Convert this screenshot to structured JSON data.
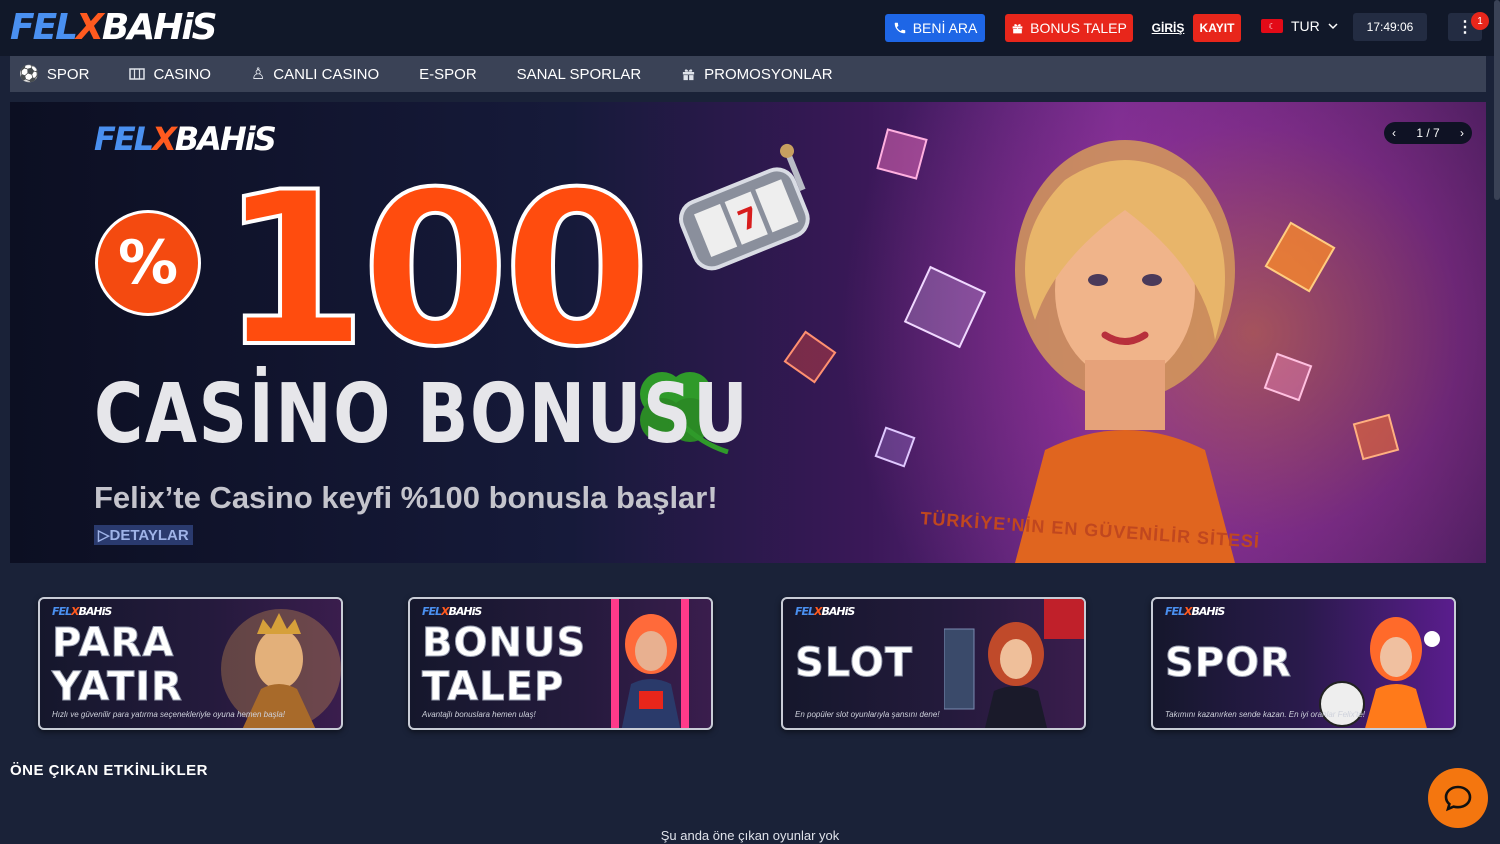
{
  "brand": {
    "part1": "FEL",
    "part2": "X",
    "part3": "BAHiS"
  },
  "header": {
    "call_label": "BENİ ARA",
    "bonus_label": "BONUS TALEP",
    "login_label": "GİRİŞ",
    "register_label": "KAYIT",
    "language": "TUR",
    "time": "17:49:06",
    "notification_count": "1"
  },
  "nav": {
    "items": [
      {
        "label": "SPOR",
        "icon": "soccer-ball-icon"
      },
      {
        "label": "CASINO",
        "icon": "slot-machine-icon"
      },
      {
        "label": "CANLI CASINO",
        "icon": "dealer-icon"
      },
      {
        "label": "E-SPOR",
        "icon": ""
      },
      {
        "label": "SANAL SPORLAR",
        "icon": ""
      },
      {
        "label": "PROMOSYONLAR",
        "icon": "gift-icon"
      }
    ]
  },
  "hero": {
    "percent": "%",
    "amount": "100",
    "title": "CASİNO BONUSU",
    "subtitle": "Felix’te Casino keyfi %100 bonusla başlar!",
    "details_label": "DETAYLAR",
    "tagline": "TÜRKİYE'NİN EN GÜVENİLİR SİTESİ",
    "pager": "1 / 7"
  },
  "promos": [
    {
      "title_line1": "PARA",
      "title_line2": "YATIR",
      "desc": "Hızlı ve güvenilir para yatırma seçenekleriyle oyuna hemen başla!"
    },
    {
      "title_line1": "BONUS",
      "title_line2": "TALEP",
      "desc": "Avantajlı bonuslara hemen ulaş!"
    },
    {
      "title_line1": "SLOT",
      "title_line2": "",
      "desc": "En popüler slot oyunlarıyla şansını dene!"
    },
    {
      "title_line1": "SPOR",
      "title_line2": "",
      "desc": "Takımını kazanırken sende kazan. En iyi oranlar Felix'te!"
    }
  ],
  "featured": {
    "title": "ÖNE ÇIKAN ETKİNLİKLER",
    "empty_message": "Şu anda öne çıkan oyunlar yok"
  },
  "colors": {
    "accent": "#e8261b",
    "primary": "#1e66e6",
    "background": "#1a2238",
    "chat": "#f4760f"
  }
}
